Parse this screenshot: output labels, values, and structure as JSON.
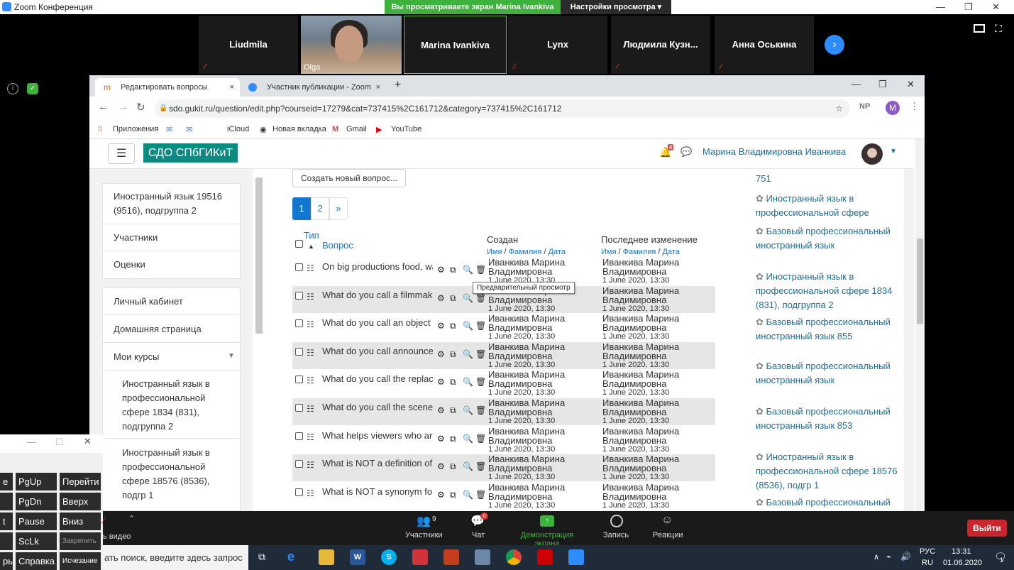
{
  "zoom": {
    "window_title": "Zoom Конференция",
    "viewing_banner": "Вы просматриваете экран Marina Ivankiva",
    "view_settings": "Настройки просмотра",
    "participants_strip": [
      "Liudmila",
      "Olga",
      "Marina Ivankiva",
      "Lynx",
      "Людмила  Кузн...",
      "Анна Оськина"
    ]
  },
  "browser": {
    "tabs": [
      {
        "label": "Редактировать вопросы",
        "close": "×"
      },
      {
        "label": "Участник публикации - Zoom",
        "close": "×"
      }
    ],
    "new_tab": "+",
    "url": "sdo.gukit.ru/question/edit.php?courseid=17279&cat=737415%2C161712&category=737415%2C161712",
    "bookmarks": [
      "Приложения",
      "iCloud",
      "Новая вкладка",
      "Gmail",
      "YouTube"
    ],
    "ext_np": "NP",
    "profile": "M"
  },
  "moodle": {
    "brand": "СДО СПбГИКиТ",
    "notif_count": "4",
    "user_name": "Марина Владимировна Иванкива",
    "left_nav": {
      "course": "Иностранный язык 19516 (9516), подгруппа 2",
      "items1": [
        "Участники",
        "Оценки"
      ],
      "items2": [
        "Личный кабинет",
        "Домашняя страница",
        "Мои курсы"
      ],
      "courses": [
        "Иностранный язык в профессиональной сфере 1834 (831), подгруппа 2",
        "Иностранный язык в профессиональной сфере 18576 (8536), подгр 1"
      ]
    },
    "create_button": "Создать новый вопрос...",
    "pagination": [
      "1",
      "2",
      "»"
    ],
    "table": {
      "col_type": "Тип",
      "col_question": "Вопрос",
      "col_created": "Создан",
      "col_modified": "Последнее изменение",
      "sort_name": "Имя",
      "sort_surname": "Фамилия",
      "sort_date": "Дата",
      "sep": "/",
      "tooltip": "Предварительный просмотр",
      "rows": [
        {
          "q": "On big productions food, water,",
          "author1": "Иванкива Марина",
          "author2": "Владимировна",
          "date": "1 June 2020, 13:30"
        },
        {
          "q": "What do you call a filmmaker",
          "author1": "Иванкива Марина",
          "author2": "Владимировна",
          "date": "1 June 2020, 13:30"
        },
        {
          "q": "What do you call an object",
          "author1": "Иванкива Марина",
          "author2": "Владимировна",
          "date": "1 June 2020, 13:30"
        },
        {
          "q": "What do you call announcements",
          "author1": "Иванкива Марина",
          "author2": "Владимировна",
          "date": "1 June 2020, 13:30"
        },
        {
          "q": "What do you call the replacement",
          "author1": "Иванкива Марина",
          "author2": "Владимировна",
          "date": "1 June 2020, 13:30"
        },
        {
          "q": "What do you call the scene",
          "author1": "Иванкива Марина",
          "author2": "Владимировна",
          "date": "1 June 2020, 13:30"
        },
        {
          "q": "What helps viewers who are",
          "author1": "Иванкива Марина",
          "author2": "Владимировна",
          "date": "1 June 2020, 13:30"
        },
        {
          "q": "What is NOT a definition of",
          "author1": "Иванкива Марина",
          "author2": "Владимировна",
          "date": "1 June 2020, 13:30"
        },
        {
          "q": "What is NOT a synonym for",
          "author1": "Иванкива Марина",
          "author2": "Владимировна",
          "date": "1 June 2020, 13:30"
        }
      ]
    },
    "right_courses": [
      "751",
      "Иностранный язык в профессиональной сфере",
      "Базовый профессиональный иностранный язык",
      "Иностранный язык в профессиональной сфере 1834 (831), подгруппа 2",
      "Базовый профессиональный иностранный язык 855",
      "Базовый профессиональный иностранный язык",
      "Базовый профессиональный иностранный язык 853",
      "Иностранный язык в профессиональной сфере 18576 (8536), подгр 1",
      "Базовый профессиональный"
    ]
  },
  "keyboard": {
    "keys": [
      [
        "е",
        "PgUp",
        "Перейти"
      ],
      [
        "",
        "PgDn",
        "Вверх"
      ],
      [
        "t",
        "Pause",
        "Вниз"
      ],
      [
        "",
        "ScLk",
        "Закрепить"
      ],
      [
        "ры",
        "Справка",
        "Исчезание"
      ]
    ]
  },
  "zoom_bar": {
    "video_label": "ь видео",
    "participants": "Участники",
    "participants_count": "9",
    "chat": "Чат",
    "chat_count": "6",
    "share": "Демонстрация экрана",
    "record": "Запись",
    "reactions": "Реакции",
    "exit": "Выйти"
  },
  "taskbar": {
    "search_placeholder": "ать поиск, введите здесь запрос",
    "lang": "РУС",
    "lang2": "RU",
    "time": "13:31",
    "date": "01.06.2020",
    "notif": "1"
  }
}
